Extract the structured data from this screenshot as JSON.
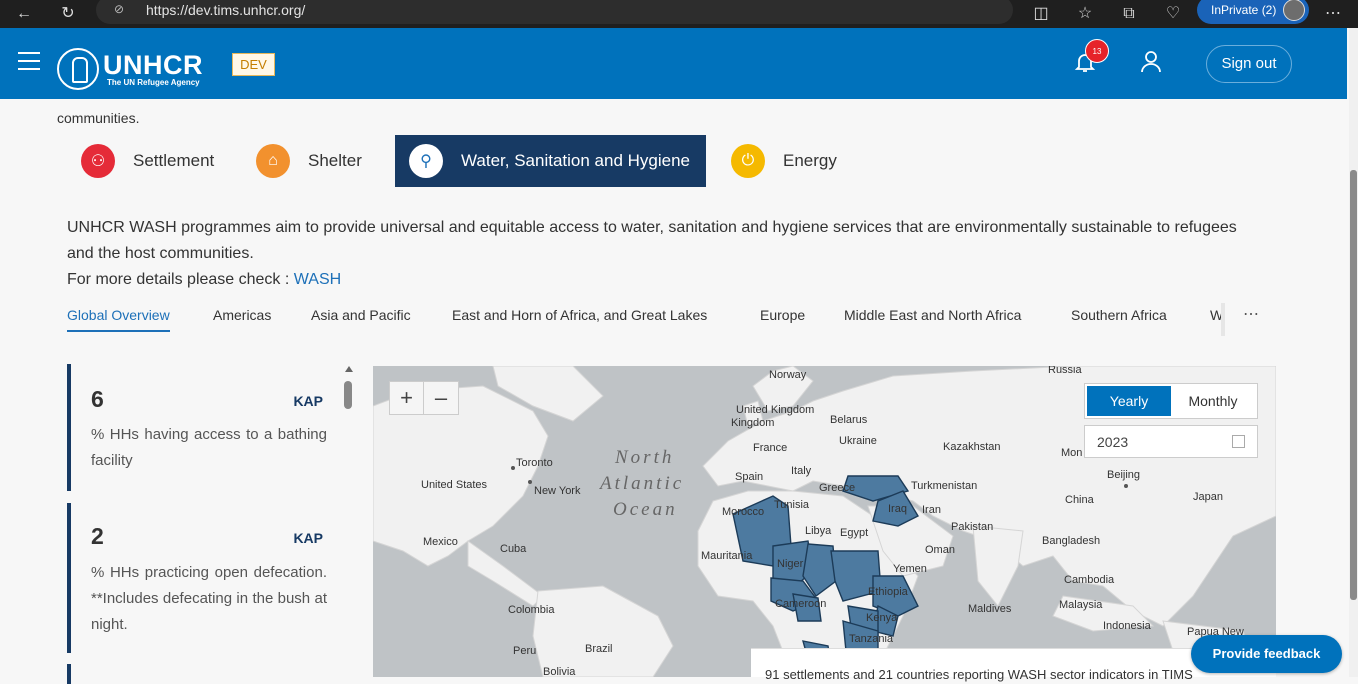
{
  "browser": {
    "url": "https://dev.tims.unhcr.org/",
    "inprivate_label": "InPrivate (2)"
  },
  "header": {
    "logo_name": "UNHCR",
    "logo_sub": "The UN Refugee Agency",
    "env_badge": "DEV",
    "notifications_count": "13",
    "signout_label": "Sign out"
  },
  "intro_tail": "communities.",
  "categories": [
    {
      "label": "Settlement",
      "icon": "people-icon",
      "color": "#e52b38"
    },
    {
      "label": "Shelter",
      "icon": "house-icon",
      "color": "#f2912e"
    },
    {
      "label": "Water, Sanitation and Hygiene",
      "icon": "water-tap-icon",
      "color": "#ffffff"
    },
    {
      "label": "Energy",
      "icon": "plug-icon",
      "color": "#f5b900"
    }
  ],
  "description": {
    "text": "UNHCR WASH programmes aim to provide universal and equitable access to water, sanitation and hygiene services that are environmentally sustainable to refugees and the host communities.",
    "more_prefix": "For more details please check : ",
    "more_link": "WASH"
  },
  "regions": {
    "tabs": [
      "Global Overview",
      "Americas",
      "Asia and Pacific",
      "East and Horn of Africa, and Great Lakes",
      "Europe",
      "Middle East and North Africa",
      "Southern Africa",
      "We"
    ],
    "active": "Global Overview"
  },
  "indicators": [
    {
      "value": "6",
      "source": "KAP",
      "label": "% HHs having access to a bathing facility"
    },
    {
      "value": "2",
      "source": "KAP",
      "label": "% HHs practicing open defecation. **Includes defecating in the bush at night."
    }
  ],
  "map": {
    "zoom_in": "+",
    "zoom_out": "–",
    "period_options": [
      "Yearly",
      "Monthly"
    ],
    "selected_period": "Yearly",
    "year": "2023",
    "highlight_color": "#4d7aa0",
    "labels": {
      "russia": "Russia",
      "norway": "Norway",
      "uk": "United Kingdom",
      "belarus": "Belarus",
      "ukraine": "Ukraine",
      "kazakhstan": "Kazakhstan",
      "mon": "Mon",
      "france": "France",
      "italy": "Italy",
      "spain": "Spain",
      "greece": "Greece",
      "turkmenistan": "Turkmenistan",
      "beijing": "Beijing",
      "toronto": "Toronto",
      "us": "United States",
      "newyork": "New York",
      "tunisia": "Tunisia",
      "morocco": "Morocco",
      "iraq": "Iraq",
      "iran": "Iran",
      "china": "China",
      "japan": "Japan",
      "libya": "Libya",
      "egypt": "Egypt",
      "pakistan": "Pakistan",
      "mexico": "Mexico",
      "cuba": "Cuba",
      "mauritania": "Mauritania",
      "bangladesh": "Bangladesh",
      "oman": "Oman",
      "niger": "Niger",
      "yemen": "Yemen",
      "cambodia": "Cambodia",
      "ethiopia": "Ethiopia",
      "colombia": "Colombia",
      "cameroon": "Cameroon",
      "maldives": "Maldives",
      "malaysia": "Malaysia",
      "kenya": "Kenya",
      "indonesia": "Indonesia",
      "tanzania": "Tanzania",
      "png": "Papua New",
      "brazil": "Brazil",
      "peru": "Peru",
      "bolivia": "Bolivia",
      "ocean1": "North",
      "ocean2": "Atlantic",
      "ocean3": "Ocean"
    },
    "footer_text": "91 settlements and 21 countries reporting WASH sector indicators in TIMS"
  },
  "feedback_label": "Provide feedback"
}
